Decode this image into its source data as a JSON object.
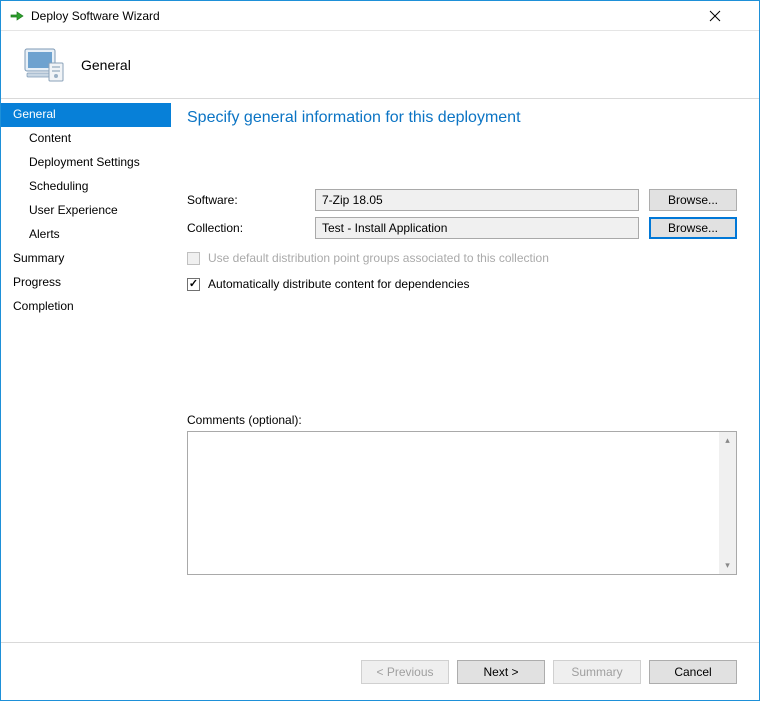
{
  "window": {
    "title": "Deploy Software Wizard"
  },
  "header": {
    "section_label": "General"
  },
  "sidebar": {
    "items": [
      {
        "label": "General",
        "sub": false,
        "active": true
      },
      {
        "label": "Content",
        "sub": true,
        "active": false
      },
      {
        "label": "Deployment Settings",
        "sub": true,
        "active": false
      },
      {
        "label": "Scheduling",
        "sub": true,
        "active": false
      },
      {
        "label": "User Experience",
        "sub": true,
        "active": false
      },
      {
        "label": "Alerts",
        "sub": true,
        "active": false
      },
      {
        "label": "Summary",
        "sub": false,
        "active": false
      },
      {
        "label": "Progress",
        "sub": false,
        "active": false
      },
      {
        "label": "Completion",
        "sub": false,
        "active": false
      }
    ]
  },
  "page": {
    "title": "Specify general information for this deployment",
    "software_label": "Software:",
    "software_value": "7-Zip 18.05",
    "collection_label": "Collection:",
    "collection_value": "Test - Install Application",
    "browse_label": "Browse...",
    "check_default_dp": "Use default distribution point groups associated to this collection",
    "check_auto_dist": "Automatically distribute content for dependencies",
    "comments_label": "Comments (optional):",
    "comments_value": ""
  },
  "footer": {
    "previous": "< Previous",
    "next": "Next >",
    "summary": "Summary",
    "cancel": "Cancel"
  }
}
